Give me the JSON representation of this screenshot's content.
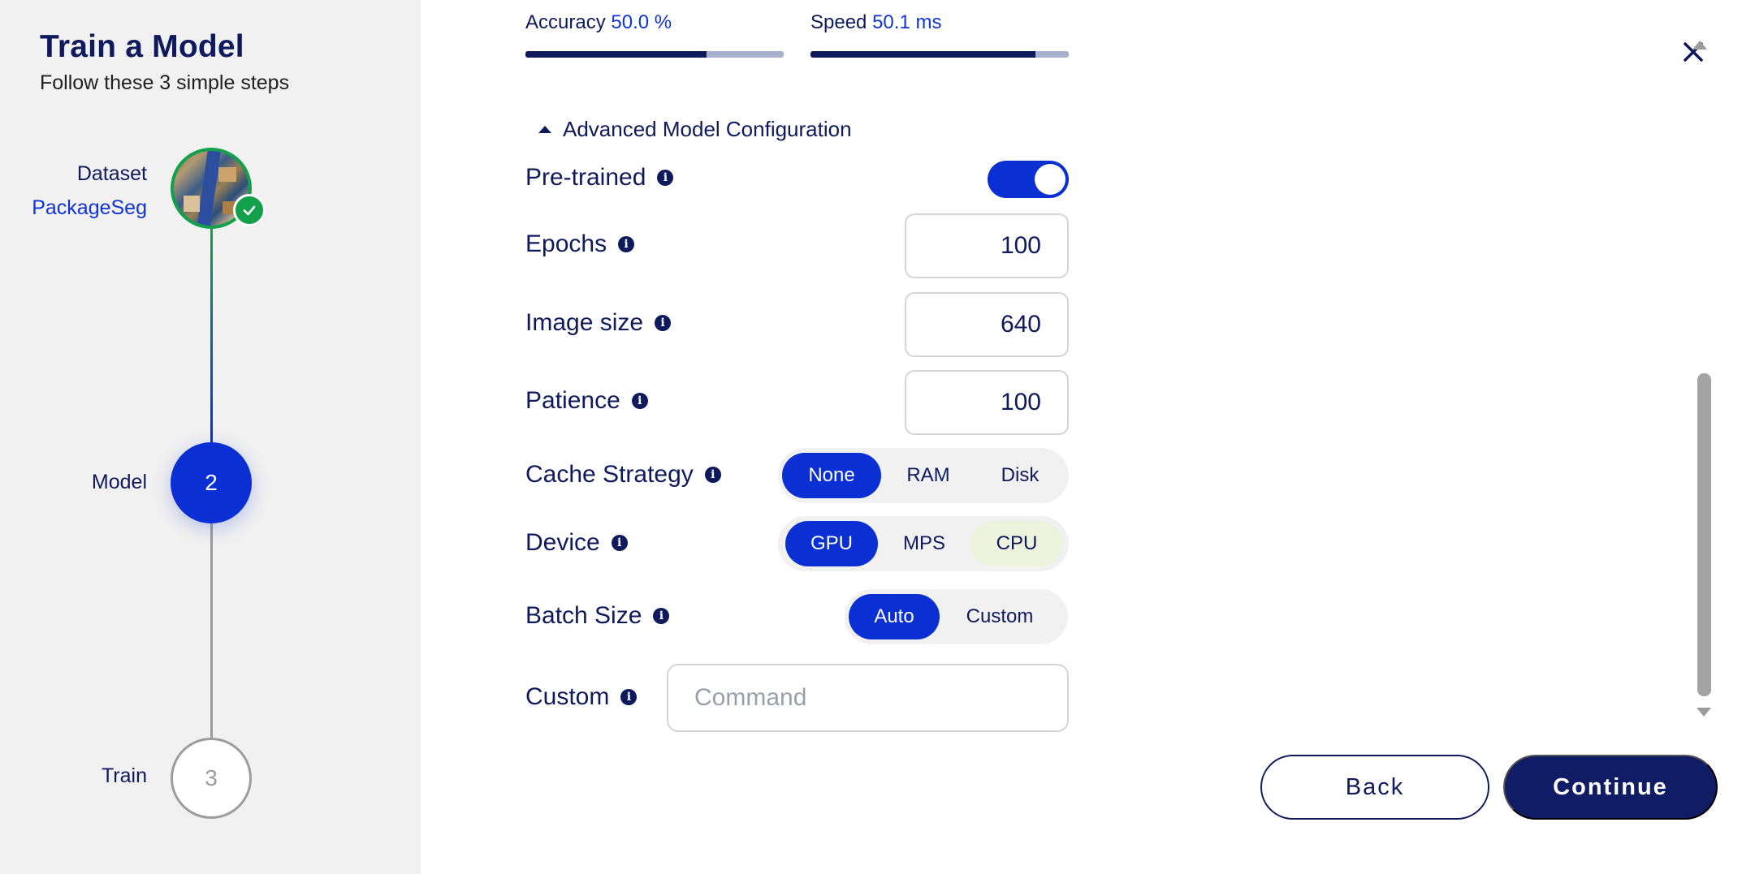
{
  "sidebar": {
    "title": "Train a Model",
    "subtitle": "Follow these 3 simple steps",
    "steps": [
      {
        "label": "Dataset",
        "sublabel": "PackageSeg",
        "status": "complete"
      },
      {
        "label": "Model",
        "number": "2",
        "status": "active"
      },
      {
        "label": "Train",
        "number": "3",
        "status": "pending"
      }
    ]
  },
  "metrics": [
    {
      "label": "Accuracy",
      "value": "50.0 %",
      "progress": 0.7
    },
    {
      "label": "Speed",
      "value": "50.1 ms",
      "progress": 0.87
    }
  ],
  "advanced": {
    "toggle_label": "Advanced Model Configuration",
    "pretrained": {
      "label": "Pre-trained",
      "enabled": true
    },
    "epochs": {
      "label": "Epochs",
      "value": "100"
    },
    "image_size": {
      "label": "Image size",
      "value": "640"
    },
    "patience": {
      "label": "Patience",
      "value": "100"
    },
    "cache_strategy": {
      "label": "Cache Strategy",
      "options": [
        "None",
        "RAM",
        "Disk"
      ],
      "selected": "None"
    },
    "device": {
      "label": "Device",
      "options": [
        "GPU",
        "MPS",
        "CPU"
      ],
      "selected": "GPU"
    },
    "batch_size": {
      "label": "Batch Size",
      "options": [
        "Auto",
        "Custom"
      ],
      "selected": "Auto"
    },
    "custom": {
      "label": "Custom",
      "placeholder": "Command",
      "value": ""
    }
  },
  "buttons": {
    "back": "Back",
    "continue": "Continue"
  },
  "colors": {
    "primary": "#0a2fd3",
    "navy": "#0f1a5c",
    "success": "#13a04b",
    "sidebar_bg": "#f1f1f1"
  },
  "icons": [
    "check-icon",
    "info-icon",
    "caret-up-icon",
    "close-icon",
    "scroll-up-icon",
    "scroll-down-icon"
  ]
}
